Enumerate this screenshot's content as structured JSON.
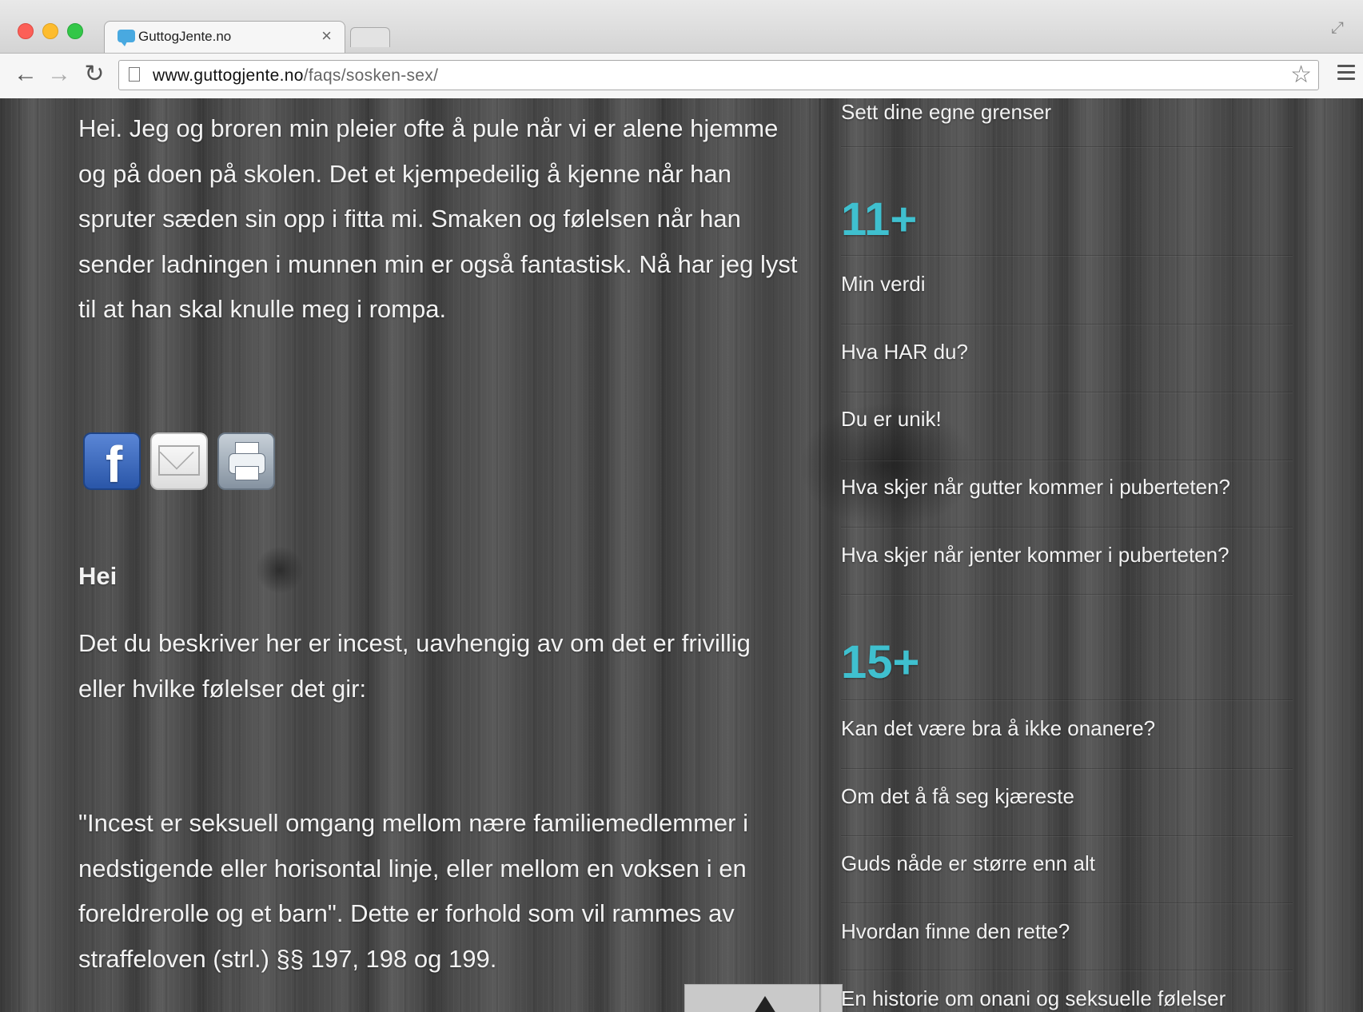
{
  "browser": {
    "tab_title": "GuttogJente.no",
    "tab_close": "×",
    "url_host": "www.guttogjente.no",
    "url_path": "/faqs/sosken-sex/"
  },
  "article": {
    "question": "Hei. Jeg og broren min pleier ofte å pule når vi er alene hjemme og på doen på skolen. Det et kjempedeilig å kjenne når han spruter sæden sin opp i fitta mi. Smaken og følelsen når han sender ladningen i munnen min er også fantastisk. Nå har jeg lyst til at han skal knulle meg i rompa.",
    "answer_heading": "Hei",
    "answer_p1": "Det du beskriver her er incest, uavhengig av om det er frivillig eller hvilke følelser det gir:",
    "answer_p2": "\"Incest er seksuell omgang mellom nære familiemedlemmer i nedstigende eller horisontal linje, eller mellom en voksen i en foreldrerolle og et barn\". Dette er forhold som vil rammes av straffeloven (strl.) §§ 197, 198 og 199."
  },
  "share": {
    "facebook_letter": "f"
  },
  "sidebar": {
    "top_item": "Sett dine egne grenser",
    "section_11": {
      "heading": "11+",
      "items": [
        "Min verdi",
        "Hva HAR du?",
        "Du er unik!",
        "Hva skjer når gutter kommer i puberteten?",
        "Hva skjer når jenter kommer i puberteten?"
      ]
    },
    "section_15": {
      "heading": "15+",
      "items": [
        "Kan det være bra å ikke onanere?",
        "Om det å få seg kjæreste",
        "Guds nåde er større enn alt",
        "Hvordan finne den rette?",
        "En historie om onani og seksuelle følelser"
      ]
    }
  },
  "colors": {
    "accent": "#3fc0cf",
    "text": "#f2f2f2"
  }
}
